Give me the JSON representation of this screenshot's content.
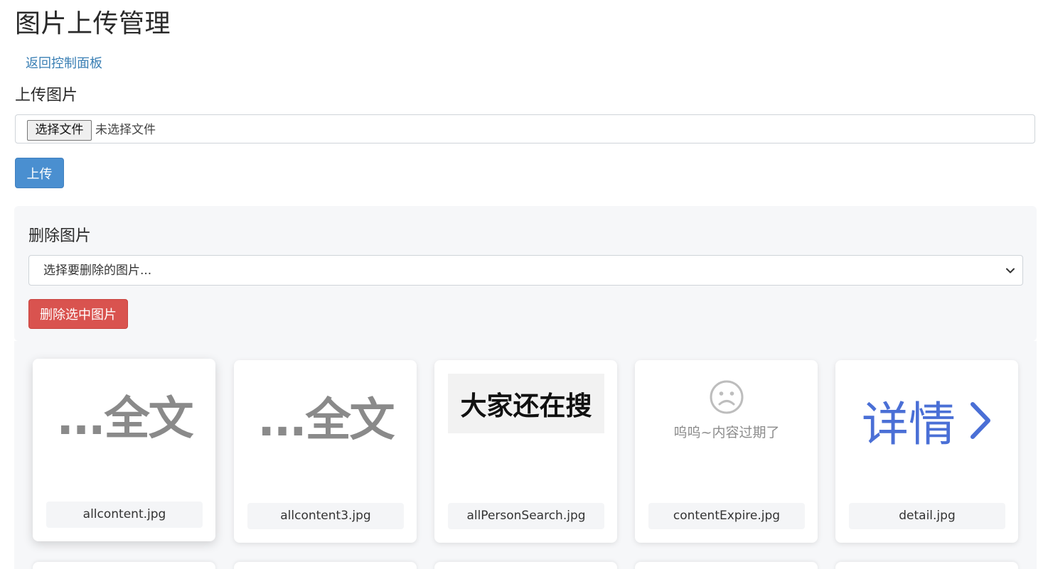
{
  "page": {
    "title": "图片上传管理",
    "back_link": "返回控制面板"
  },
  "upload": {
    "heading": "上传图片",
    "choose_file_label": "选择文件",
    "file_status": "未选择文件",
    "submit_label": "上传"
  },
  "delete": {
    "heading": "删除图片",
    "select_value": "选择要删除的图片...",
    "submit_label": "删除选中图片"
  },
  "images": [
    {
      "filename": "allcontent.jpg",
      "thumb_text": "...全文"
    },
    {
      "filename": "allcontent3.jpg",
      "thumb_text": "...全文"
    },
    {
      "filename": "allPersonSearch.jpg",
      "thumb_text": "大家还在搜"
    },
    {
      "filename": "contentExpire.jpg",
      "thumb_text": "呜呜~内容过期了",
      "thumb_icon": "sad-face-icon"
    },
    {
      "filename": "detail.jpg",
      "thumb_text": "详情",
      "thumb_icon": "chevron-right-icon"
    }
  ],
  "colors": {
    "link": "#3a7fb4",
    "primary_button": "#4a8fd0",
    "danger_button": "#d9534f",
    "panel_bg": "#f6f7f9",
    "detail_blue": "#4a6fd6"
  }
}
